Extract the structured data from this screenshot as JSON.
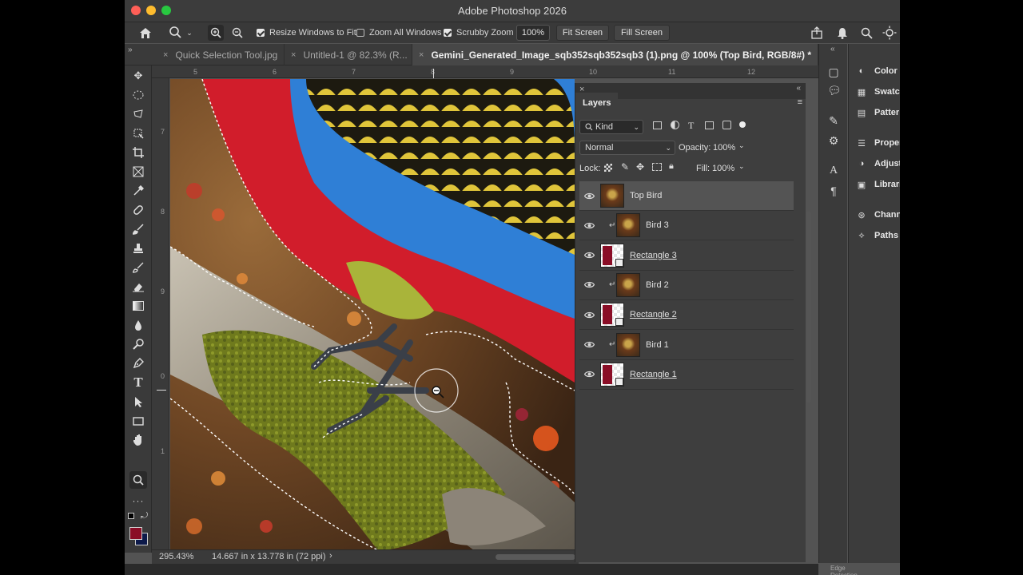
{
  "window": {
    "title": "Adobe Photoshop 2026"
  },
  "options_bar": {
    "zoom_tool_glyph": "🔍",
    "resize_windows": {
      "label": "Resize Windows to Fit",
      "checked": true
    },
    "zoom_all_windows": {
      "label": "Zoom All Windows",
      "checked": false
    },
    "scrubby_zoom": {
      "label": "Scrubby Zoom",
      "checked": true
    },
    "zoom_value": "100%",
    "fit_screen_label": "Fit Screen",
    "fill_screen_label": "Fill Screen"
  },
  "tabs": [
    {
      "label": "Quick Selection Tool.jpg",
      "close": "×"
    },
    {
      "label": "Untitled-1 @ 82.3% (R...",
      "close": "×"
    },
    {
      "label": "Gemini_Generated_Image_sqb352sqb352sqb3 (1).png @ 100% (Top Bird, RGB/8#) *",
      "close": "×",
      "active": true
    }
  ],
  "rulers": {
    "top": [
      "5",
      "6",
      "7",
      "8",
      "9",
      "10",
      "11",
      "12"
    ],
    "left": [
      "7",
      "8",
      "9",
      "0",
      "1"
    ]
  },
  "status": {
    "zoom": "295.43%",
    "doc_size": "14.667 in x 13.778 in (72 ppi)",
    "arrow": "›"
  },
  "layers_panel": {
    "title": "Layers",
    "filter_kind": "Kind",
    "blend_mode": "Normal",
    "opacity_label": "Opacity:",
    "opacity_value": "100%",
    "lock_label": "Lock:",
    "fill_label": "Fill:",
    "fill_value": "100%",
    "layers": [
      {
        "name": "Top Bird",
        "thumb": "bird",
        "clipped": false,
        "underline": false,
        "active": true
      },
      {
        "name": "Bird 3",
        "thumb": "bird",
        "clipped": true,
        "underline": false,
        "active": false
      },
      {
        "name": "Rectangle 3",
        "thumb": "rect",
        "clipped": false,
        "underline": true,
        "active": false
      },
      {
        "name": "Bird 2",
        "thumb": "bird",
        "clipped": true,
        "underline": false,
        "active": false
      },
      {
        "name": "Rectangle 2",
        "thumb": "rect",
        "clipped": false,
        "underline": true,
        "active": false
      },
      {
        "name": "Bird 1",
        "thumb": "bird",
        "clipped": true,
        "underline": false,
        "active": false
      },
      {
        "name": "Rectangle 1",
        "thumb": "rect",
        "clipped": false,
        "underline": true,
        "active": false
      }
    ]
  },
  "right_dock": {
    "panels": [
      {
        "label": "Color",
        "icon": "palette-icon"
      },
      {
        "label": "Swatch",
        "icon": "grid-icon"
      },
      {
        "label": "Patter",
        "icon": "pattern-icon"
      },
      {
        "label": "Proper",
        "icon": "sliders-icon"
      },
      {
        "label": "Adjust",
        "icon": "adjust-icon"
      },
      {
        "label": "Librari",
        "icon": "library-icon"
      },
      {
        "label": "Chann",
        "icon": "channels-icon"
      },
      {
        "label": "Paths",
        "icon": "paths-icon"
      }
    ]
  },
  "bottom_hint": "Edge Detection",
  "colors": {
    "foreground": "#8a0d26",
    "background": "#0d1a4a"
  }
}
